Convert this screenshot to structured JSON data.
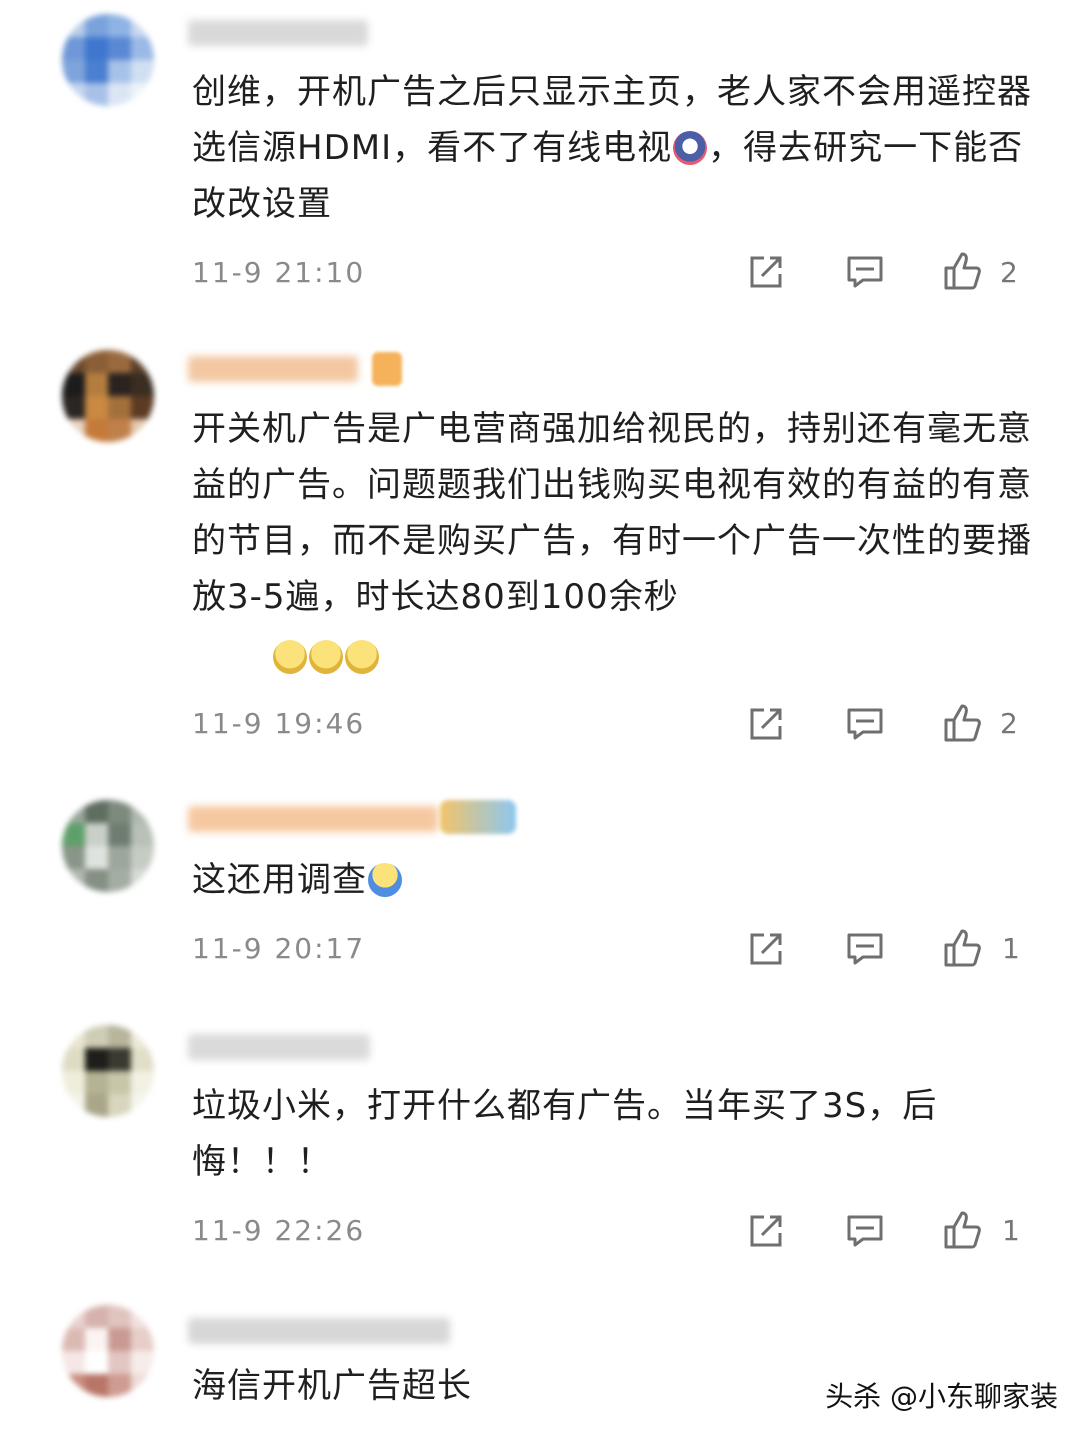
{
  "comments": [
    {
      "text": "创维，开机广告之后只显示主页，老人家不会用遥控器选信源HDMI，看不了有线电视",
      "text_after_emoji": "，得去研究一下能否改改设置",
      "time": "11-9 21:10",
      "likes": "2"
    },
    {
      "text": "开关机广告是广电营商强加给视民的，持别还有毫无意益的广告。问题题我们出钱购买电视有效的有益的有意的节目，而不是购买广告，有时一个广告一次性的要播放3-5遍，时长达80到100余秒",
      "time": "11-9 19:46",
      "likes": "2"
    },
    {
      "text": "这还用调查",
      "time": "11-9 20:17",
      "likes": "1"
    },
    {
      "text": "垃圾小米，打开什么都有广告。当年买了3S，后悔！！！",
      "time": "11-9 22:26",
      "likes": "1"
    },
    {
      "text": "海信开机广告超长"
    }
  ],
  "watermark": "头杀 @小东聊家装",
  "icons": {
    "share": "share-icon",
    "reply": "reply-icon",
    "like": "thumbs-up-icon"
  },
  "colors": {
    "text": "#1f1f1f",
    "meta": "#8a8a8a",
    "icon": "#6f6f6f"
  }
}
